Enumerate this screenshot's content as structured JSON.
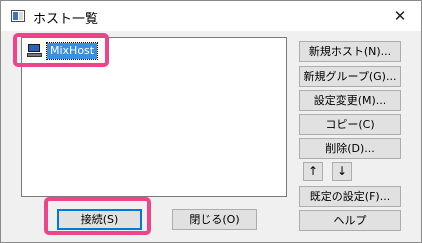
{
  "window": {
    "title": "ホスト一覧",
    "close_glyph": "✕"
  },
  "host_list": {
    "items": [
      {
        "label": "MixHost",
        "selected": true
      }
    ]
  },
  "buttons": {
    "new_host": "新規ホスト(N)...",
    "new_group": "新規グループ(G)...",
    "edit_settings": "設定変更(M)...",
    "copy": "コピー(C)",
    "delete": "削除(D)...",
    "move_up": "↑",
    "move_down": "↓",
    "default_settings": "既定の設定(F)...",
    "help": "ヘルプ",
    "connect": "接続(S)",
    "close": "閉じる(O)"
  },
  "colors": {
    "highlight_border": "#f0448a",
    "selection": "#3b8fe0",
    "default_button_border": "#0078d7"
  },
  "icons": {
    "app": "app-window-icon",
    "host": "computer-icon",
    "close": "close-icon"
  }
}
